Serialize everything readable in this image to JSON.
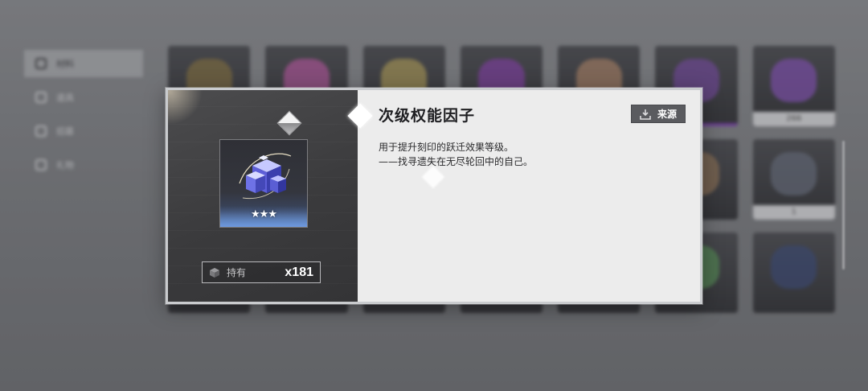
{
  "sidebar": {
    "items": [
      {
        "label": "材料",
        "icon": "materials-icon",
        "active": true
      },
      {
        "label": "道具",
        "icon": "props-icon",
        "active": false
      },
      {
        "label": "招募",
        "icon": "recruit-icon",
        "active": false
      },
      {
        "label": "礼物",
        "icon": "gift-icon",
        "active": false
      }
    ]
  },
  "grid": {
    "visible_counts": [
      "266",
      "1"
    ]
  },
  "modal": {
    "item_name": "次级权能因子",
    "stars": "★★★",
    "owned_label": "持有",
    "owned_count": "x181",
    "source_button_label": "来源",
    "description_line1": "用于提升刻印的跃迁效果等级。",
    "description_line2": "——找寻遗失在无尽轮回中的自己。",
    "rarity_stars": 3
  },
  "colors": {
    "modal_left_bg": "#3f3f41",
    "modal_right_bg": "#ececec",
    "button_bg": "#5a5b5f",
    "title_text": "#1f1f22",
    "item_glow": "#6f9cf0"
  }
}
